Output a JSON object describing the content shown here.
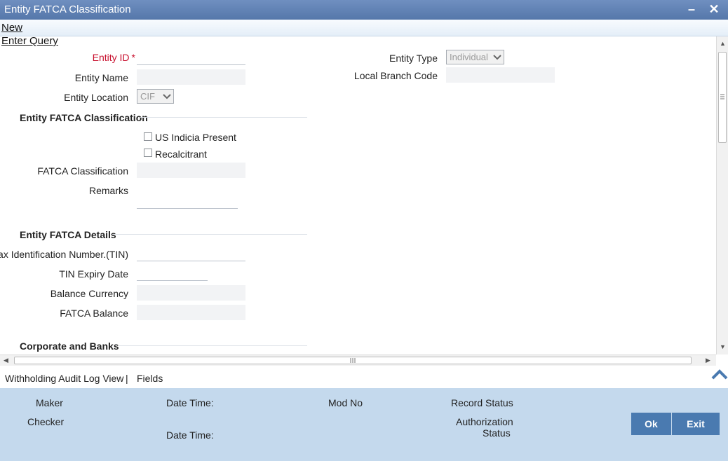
{
  "window": {
    "title": "Entity FATCA Classification",
    "minimize_glyph": "–",
    "close_glyph": "✕"
  },
  "menu": {
    "new": "New",
    "enter_query": "Enter Query"
  },
  "form": {
    "entity_id_label": "Entity ID",
    "required_marker": "*",
    "entity_name_label": "Entity Name",
    "entity_location_label": "Entity Location",
    "entity_location_value": "CIF",
    "entity_type_label": "Entity Type",
    "entity_type_value": "Individual",
    "local_branch_code_label": "Local Branch Code"
  },
  "classification": {
    "section_title": "Entity FATCA Classification",
    "us_indicia_label": "US Indicia Present",
    "recalcitrant_label": "Recalcitrant",
    "fatca_classification_label": "FATCA Classification",
    "remarks_label": "Remarks"
  },
  "details": {
    "section_title": "Entity FATCA Details",
    "tin_label": "Tax Identification Number.(TIN)",
    "tin_expiry_label": "TIN Expiry Date",
    "balance_currency_label": "Balance Currency",
    "fatca_balance_label": "FATCA Balance"
  },
  "corporate": {
    "section_title": "Corporate and Banks"
  },
  "tabs": {
    "audit": "Withholding Audit Log View",
    "separator": "|",
    "fields": "Fields"
  },
  "footer": {
    "maker": "Maker",
    "checker": "Checker",
    "date_time": "Date Time:",
    "mod_no": "Mod No",
    "record_status": "Record Status",
    "authorization": "Authorization",
    "status": "Status",
    "ok": "Ok",
    "exit": "Exit"
  },
  "colors": {
    "title_bar": "#5b7db5",
    "footer_bg": "#c4d9ed",
    "button": "#4a7ab0",
    "required": "#c8102e"
  }
}
